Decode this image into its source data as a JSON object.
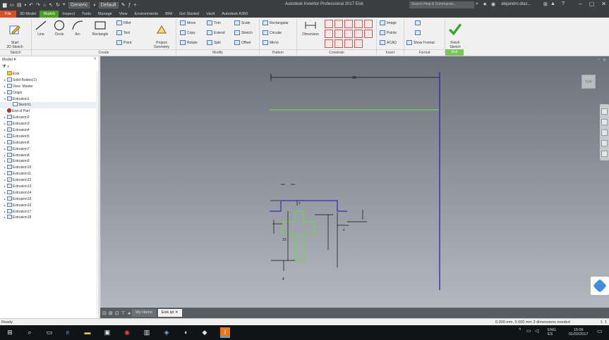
{
  "titlebar": {
    "style_combo": "Generic",
    "color_combo": "Default",
    "app_title": "Autodesk Inventor Professional 2017   Eixk",
    "search_placeholder": "Search Help & Commands...",
    "user": "alejandro.diaz...",
    "min_icon": "–",
    "max_icon": "▢",
    "close_icon": "✕"
  },
  "ribbon_tabs": [
    "File",
    "3D Model",
    "Sketch",
    "Inspect",
    "Tools",
    "Manage",
    "View",
    "Environments",
    "BIM",
    "Get Started",
    "Vault",
    "Autodesk A360"
  ],
  "active_tab": "Sketch",
  "ribbon": {
    "sketch_group": {
      "start_label": "Start\n2D Sketch",
      "group_label": "Sketch"
    },
    "create_group": {
      "line": "Line",
      "circle": "Circle",
      "arc": "Arc",
      "rectangle": "Rectangle",
      "fillet": "Fillet",
      "text": "Text",
      "point": "Point",
      "project_geometry": "Project\nGeometry",
      "group_label": "Create"
    },
    "modify_group": {
      "move": "Move",
      "trim": "Trim",
      "scale": "Scale",
      "copy": "Copy",
      "extend": "Extend",
      "stretch": "Stretch",
      "rotate": "Rotate",
      "split": "Split",
      "offset": "Offset",
      "group_label": "Modify"
    },
    "pattern_group": {
      "rectangular": "Rectangular",
      "circular": "Circular",
      "mirror": "Mirror",
      "group_label": "Pattern"
    },
    "constrain_group": {
      "dimension": "Dimension",
      "group_label": "Constrain"
    },
    "insert_group": {
      "image": "Image",
      "points": "Points",
      "acad": "ACAD",
      "group_label": "Insert"
    },
    "format_group": {
      "show_format": "Show Format",
      "group_label": "Format"
    },
    "exit_group": {
      "finish_sketch": "Finish\nSketch",
      "group_label": "Exit"
    }
  },
  "browser": {
    "title": "Model",
    "tree": [
      {
        "label": "Eixk",
        "type": "part",
        "expand": ""
      },
      {
        "label": "Solid Bodies(1)",
        "type": "folder",
        "expand": "▸"
      },
      {
        "label": "View: Master",
        "type": "folder",
        "expand": "▸"
      },
      {
        "label": "Origin",
        "type": "folder",
        "expand": "▸"
      },
      {
        "label": "Extrusion1",
        "type": "feature",
        "expand": "▾"
      },
      {
        "label": "Sketch1",
        "type": "sketch",
        "expand": ""
      },
      {
        "label": "End of Part",
        "type": "eop",
        "expand": ""
      },
      {
        "label": "Extrusion2",
        "type": "feature",
        "expand": "▸"
      },
      {
        "label": "Extrusion3",
        "type": "feature",
        "expand": "▸"
      },
      {
        "label": "Extrusion4",
        "type": "feature",
        "expand": "▸"
      },
      {
        "label": "Extrusion5",
        "type": "feature",
        "expand": "▸"
      },
      {
        "label": "Extrusion6",
        "type": "feature",
        "expand": "▸"
      },
      {
        "label": "Extrusion7",
        "type": "feature",
        "expand": "▸"
      },
      {
        "label": "Extrusion8",
        "type": "feature",
        "expand": "▸"
      },
      {
        "label": "Extrusion9",
        "type": "feature",
        "expand": "▸"
      },
      {
        "label": "Extrusion10",
        "type": "feature",
        "expand": "▸"
      },
      {
        "label": "Extrusion11",
        "type": "feature",
        "expand": "▸"
      },
      {
        "label": "Extrusion12",
        "type": "feature",
        "expand": "▸"
      },
      {
        "label": "Extrusion13",
        "type": "feature",
        "expand": "▸"
      },
      {
        "label": "Extrusion14",
        "type": "feature",
        "expand": "▸"
      },
      {
        "label": "Extrusion15",
        "type": "feature",
        "expand": "▸"
      },
      {
        "label": "Extrusion16",
        "type": "feature",
        "expand": "▸"
      },
      {
        "label": "Extrusion17",
        "type": "feature",
        "expand": "▸"
      },
      {
        "label": "Extrusion18",
        "type": "feature",
        "expand": "▸"
      }
    ]
  },
  "canvas": {
    "viewcube_label": "TOP",
    "dim_top": "20",
    "dim_10": "10",
    "dim_4": "4",
    "dim_small_a": "3",
    "dim_small_b": "4"
  },
  "doc_tabs": {
    "home": "My Home",
    "file": "Eixk.ipt"
  },
  "status": {
    "left": "Ready",
    "right": "0.000 mm, 0.000 mm  3 dimensions needed",
    "num1": "1",
    "num2": "1"
  },
  "taskbar": {
    "time": "15:06",
    "date": "01/02/2017",
    "lang": "ENG\nES"
  },
  "colors": {
    "active_tab": "#4e9a2a",
    "file_tab": "#d8502a",
    "sketch_green": "#76d34a",
    "sketch_blue": "#3a2aa8"
  }
}
